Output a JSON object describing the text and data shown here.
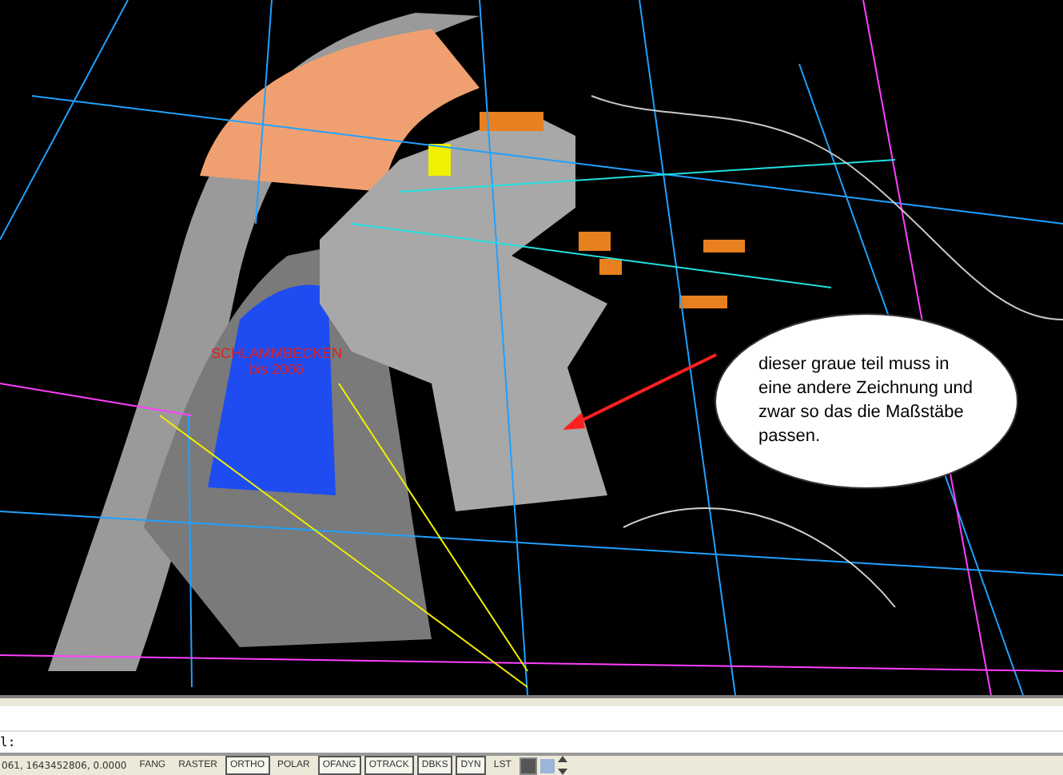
{
  "drawing": {
    "basin_label": [
      "SCHLAMMBECKEN",
      "bis 2006"
    ],
    "callout": "dieser graue teil muss in eine andere Zeichnung und zwar so das die Maßstäbe passen."
  },
  "command_line": {
    "prompt": "l:"
  },
  "status_bar": {
    "coordinates": "061, 1643452806, 0.0000",
    "toggles": [
      {
        "label": "FANG",
        "on": false
      },
      {
        "label": "RASTER",
        "on": false
      },
      {
        "label": "ORTHO",
        "on": true
      },
      {
        "label": "POLAR",
        "on": false
      },
      {
        "label": "OFANG",
        "on": true
      },
      {
        "label": "OTRACK",
        "on": true
      },
      {
        "label": "DBKS",
        "on": true
      },
      {
        "label": "DYN",
        "on": true
      },
      {
        "label": "LST",
        "on": false
      }
    ]
  }
}
